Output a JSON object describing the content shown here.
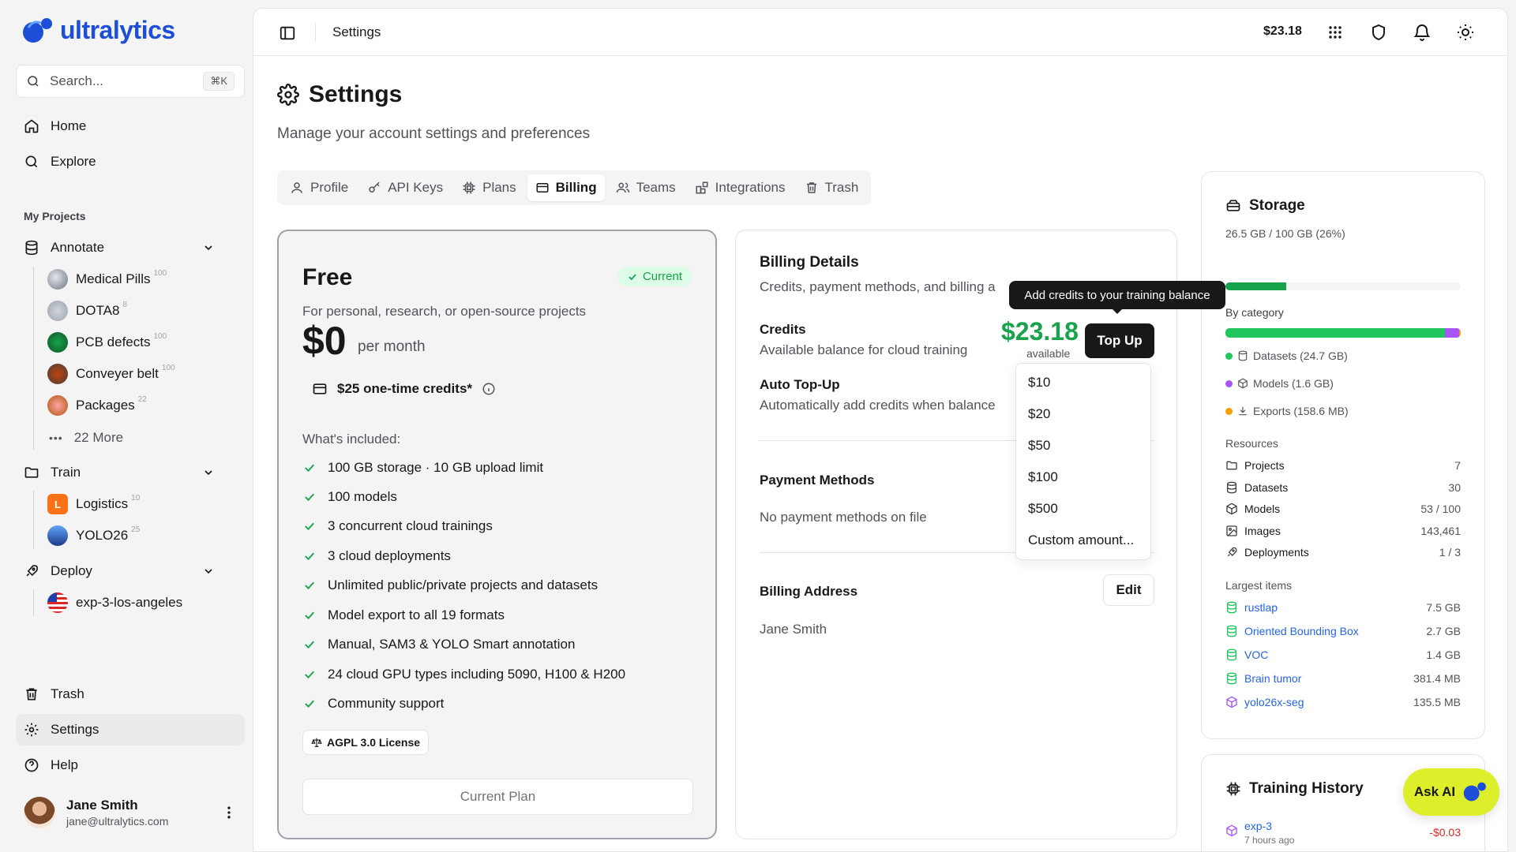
{
  "app": {
    "logo_text": "ultralytics",
    "brand_color": "#1d4ed8",
    "accent_green": "#16a34a",
    "ask_ai_color": "#dcef2a"
  },
  "sidebar": {
    "search_placeholder": "Search...",
    "search_shortcut": "⌘K",
    "nav": [
      {
        "label": "Home",
        "icon": "home-icon"
      },
      {
        "label": "Explore",
        "icon": "search-icon"
      }
    ],
    "my_projects_label": "My Projects",
    "annotate": {
      "label": "Annotate",
      "projects": [
        {
          "name": "Medical Pills",
          "count": "100"
        },
        {
          "name": "DOTA8",
          "count": "8"
        },
        {
          "name": "PCB defects",
          "count": "100"
        },
        {
          "name": "Conveyer belt",
          "count": "100"
        },
        {
          "name": "Packages",
          "count": "22"
        }
      ],
      "more": "22 More"
    },
    "train": {
      "label": "Train",
      "projects": [
        {
          "name": "Logistics",
          "count": "10",
          "letter": "L"
        },
        {
          "name": "YOLO26",
          "count": "25"
        }
      ]
    },
    "deploy": {
      "label": "Deploy",
      "items": [
        {
          "name": "exp-3-los-angeles"
        }
      ]
    },
    "bottom": {
      "trash": "Trash",
      "settings": "Settings",
      "help": "Help"
    },
    "user": {
      "name": "Jane Smith",
      "email": "jane@ultralytics.com"
    }
  },
  "topbar": {
    "breadcrumb": "Settings",
    "balance": "$23.18"
  },
  "page": {
    "title": "Settings",
    "subtitle": "Manage your account settings and preferences",
    "tabs": [
      {
        "label": "Profile",
        "icon": "user-icon"
      },
      {
        "label": "API Keys",
        "icon": "key-icon"
      },
      {
        "label": "Plans",
        "icon": "chip-icon"
      },
      {
        "label": "Billing",
        "icon": "card-icon",
        "active": true
      },
      {
        "label": "Teams",
        "icon": "users-icon"
      },
      {
        "label": "Integrations",
        "icon": "integrations-icon"
      },
      {
        "label": "Trash",
        "icon": "trash-icon"
      }
    ]
  },
  "plan": {
    "name": "Free",
    "badge": "Current",
    "description": "For personal, research, or open-source projects",
    "price": "$0",
    "period": "per month",
    "credits": "$25 one-time credits*",
    "included_label": "What's included:",
    "features": [
      "100 GB storage · 10 GB upload limit",
      "100 models",
      "3 concurrent cloud trainings",
      "3 cloud deployments",
      "Unlimited public/private projects and datasets",
      "Model export to all 19 formats",
      "Manual, SAM3 & YOLO Smart annotation",
      "24 cloud GPU types including 5090, H100 & H200",
      "Community support"
    ],
    "license": "AGPL 3.0 License",
    "button": "Current Plan"
  },
  "billing": {
    "title": "Billing Details",
    "subtitle": "Credits, payment methods, and billing a",
    "credits_title": "Credits",
    "credits_sub": "Available balance for cloud training",
    "amount": "$23.18",
    "available": "available",
    "topup": "Top Up",
    "tooltip": "Add credits to your training balance",
    "auto_title": "Auto Top-Up",
    "auto_sub": "Automatically add credits when balance",
    "payment_title": "Payment Methods",
    "payment_empty": "No payment methods on file",
    "address_title": "Billing Address",
    "address_edit": "Edit",
    "address_name": "Jane Smith",
    "topup_options": [
      "$10",
      "$20",
      "$50",
      "$100",
      "$500",
      "Custom amount..."
    ]
  },
  "storage": {
    "title": "Storage",
    "usage": "26.5 GB / 100 GB (26%)",
    "usage_fraction": 0.26,
    "by_category": "By category",
    "categories": [
      {
        "label": "Datasets (24.7 GB)",
        "color": "#22c55e",
        "fraction": 0.932
      },
      {
        "label": "Models (1.6 GB)",
        "color": "#a855f7",
        "fraction": 0.06
      },
      {
        "label": "Exports (158.6 MB)",
        "color": "#f59e0b",
        "fraction": 0.008
      }
    ],
    "resources_label": "Resources",
    "resources": [
      {
        "label": "Projects",
        "value": "7",
        "icon": "folder-icon"
      },
      {
        "label": "Datasets",
        "value": "30",
        "icon": "database-icon"
      },
      {
        "label": "Models",
        "value": "53 / 100",
        "icon": "cube-icon"
      },
      {
        "label": "Images",
        "value": "143,461",
        "icon": "image-icon"
      },
      {
        "label": "Deployments",
        "value": "1 / 3",
        "icon": "rocket-icon"
      }
    ],
    "largest_label": "Largest items",
    "largest": [
      {
        "label": "rustlap",
        "value": "7.5 GB",
        "kind": "dataset"
      },
      {
        "label": "Oriented Bounding Box",
        "value": "2.7 GB",
        "kind": "dataset"
      },
      {
        "label": "VOC",
        "value": "1.4 GB",
        "kind": "dataset"
      },
      {
        "label": "Brain tumor",
        "value": "381.4 MB",
        "kind": "dataset"
      },
      {
        "label": "yolo26x-seg",
        "value": "135.5 MB",
        "kind": "model"
      }
    ]
  },
  "history": {
    "title": "Training History",
    "items": [
      {
        "name": "exp-3",
        "time": "7 hours ago",
        "cost": "-$0.03"
      }
    ]
  },
  "ask_ai": {
    "label": "Ask AI"
  }
}
